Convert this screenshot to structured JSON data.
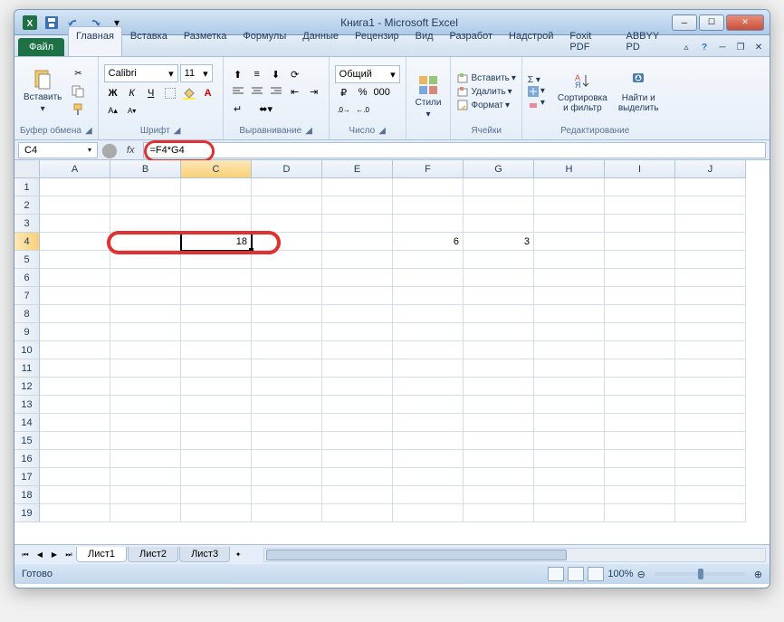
{
  "title": "Книга1  -  Microsoft Excel",
  "tabs": {
    "file": "Файл",
    "items": [
      "Главная",
      "Вставка",
      "Разметка",
      "Формулы",
      "Данные",
      "Рецензир",
      "Вид",
      "Разработ",
      "Надстрой",
      "Foxit PDF",
      "ABBYY PD"
    ],
    "active_index": 0
  },
  "ribbon": {
    "clipboard": {
      "paste": "Вставить",
      "label": "Буфер обмена"
    },
    "font": {
      "name": "Calibri",
      "size": "11",
      "label": "Шрифт"
    },
    "align": {
      "label": "Выравнивание"
    },
    "number": {
      "format": "Общий",
      "label": "Число"
    },
    "styles": {
      "label": "Стили",
      "btn": "Стили"
    },
    "cells": {
      "insert": "Вставить",
      "delete": "Удалить",
      "format": "Формат",
      "label": "Ячейки"
    },
    "editing": {
      "sort": "Сортировка\nи фильтр",
      "find": "Найти и\nвыделить",
      "label": "Редактирование"
    }
  },
  "formula_bar": {
    "cell_ref": "C4",
    "fx": "fx",
    "formula": "=F4*G4"
  },
  "columns": [
    "A",
    "B",
    "C",
    "D",
    "E",
    "F",
    "G",
    "H",
    "I",
    "J"
  ],
  "rows_visible": 19,
  "selected_col": "C",
  "selected_row": 4,
  "cells": {
    "C4": "18",
    "F4": "6",
    "G4": "3"
  },
  "sheets": {
    "items": [
      "Лист1",
      "Лист2",
      "Лист3"
    ],
    "active_index": 0
  },
  "status": {
    "text": "Готово",
    "zoom": "100%"
  }
}
